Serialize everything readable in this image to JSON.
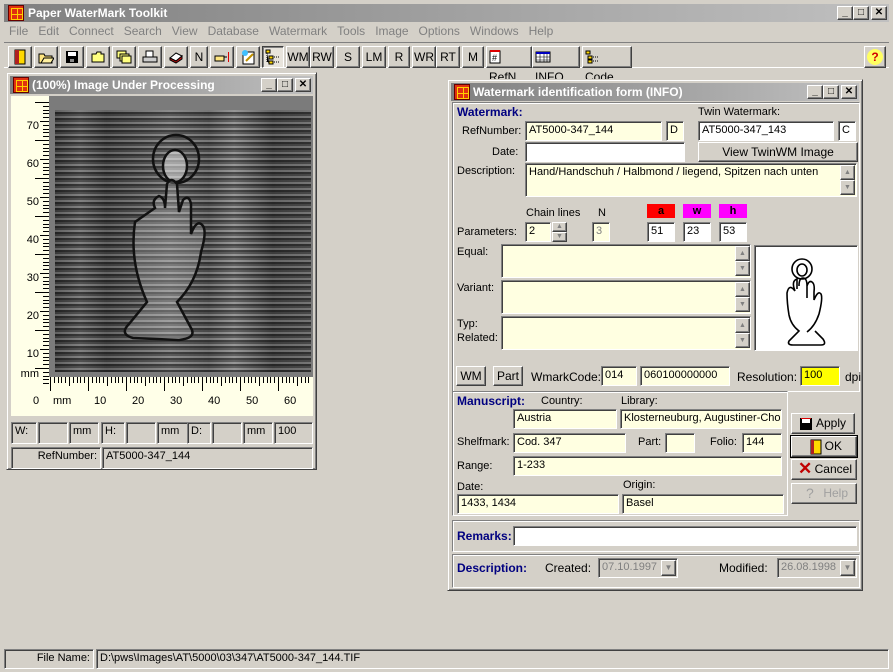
{
  "app": {
    "title": "Paper WaterMark Toolkit"
  },
  "menu": [
    "File",
    "Edit",
    "Connect",
    "Search",
    "View",
    "Database",
    "Watermark",
    "Tools",
    "Image",
    "Options",
    "Windows",
    "Help"
  ],
  "toolbar": {
    "text_buttons": {
      "n": "N",
      "wm": "WM",
      "rw": "RW",
      "s": "S",
      "lm": "LM",
      "r": "R",
      "wr": "WR",
      "rt": "RT",
      "m": "M",
      "refn": "RefN",
      "info": "INFO",
      "code": "Code"
    },
    "help_glyph": "?"
  },
  "image_window": {
    "title": "(100%) Image Under Processing",
    "vruler_labels": [
      "70",
      "60",
      "50",
      "40",
      "30",
      "20",
      "10",
      "mm"
    ],
    "hruler_labels": [
      "0",
      "mm",
      "10",
      "20",
      "30",
      "40",
      "50",
      "60"
    ],
    "measure": {
      "w_label": "W:",
      "w_value": "",
      "w_unit": "mm",
      "h_label": "H:",
      "h_value": "",
      "h_unit": "mm",
      "d_label": "D:",
      "d_value": "",
      "d_unit": "mm",
      "zoom": "100"
    },
    "refnumber_label": "RefNumber:",
    "refnumber_value": "AT5000-347_144"
  },
  "info_form": {
    "title": "Watermark identification form (INFO)",
    "watermark_section": "Watermark:",
    "refnumber_label": "RefNumber:",
    "refnumber_value": "AT5000-347_144",
    "refnumber_suffix": "D",
    "twin_label": "Twin Watermark:",
    "twin_value": "AT5000-347_143",
    "twin_suffix": "C",
    "date_label": "Date:",
    "date_value": "",
    "view_twin_button": "View TwinWM Image",
    "description_label": "Description:",
    "description_value": "Hand/Handschuh / Halbmond / liegend, Spitzen nach unten",
    "parameters_label": "Parameters:",
    "chain_lines_label": "Chain lines",
    "chain_lines_value": "2",
    "n_label": "N",
    "n_value": "3",
    "a_label": "a",
    "a_value": "51",
    "w_label": "w",
    "w_value": "23",
    "h_label": "h",
    "h_value": "53",
    "colors": {
      "a": "#ff0000",
      "w": "#ff00ff",
      "h": "#ff00ff",
      "resolution_bg": "#ffff00"
    },
    "equal_label": "Equal:",
    "equal_value": "",
    "variant_label": "Variant:",
    "variant_value": "",
    "typ_label": "Typ:",
    "related_label": "Related:",
    "typ_value": "",
    "wm_button": "WM",
    "part_button": "Part",
    "wmarkcode_label": "WmarkCode:",
    "wmarkcode_1": "014",
    "wmarkcode_2": "060100000000",
    "resolution_label": "Resolution:",
    "resolution_value": "100",
    "resolution_unit": "dpi",
    "manuscript_section": "Manuscript:",
    "country_label": "Country:",
    "country_value": "Austria",
    "library_label": "Library:",
    "library_value": "Klosterneuburg, Augustiner-Chor",
    "shelfmark_label": "Shelfmark:",
    "shelfmark_value": "Cod. 347",
    "part_label": "Part:",
    "part_value": "",
    "folio_label": "Folio:",
    "folio_value": "144",
    "range_label": "Range:",
    "range_value": "1-233",
    "ms_date_label": "Date:",
    "ms_date_value": "1433, 1434",
    "origin_label": "Origin:",
    "origin_value": "Basel",
    "apply_button": "Apply",
    "ok_button": "OK",
    "cancel_button": "Cancel",
    "help_button": "Help",
    "remarks_label": "Remarks:",
    "remarks_value": "",
    "description_section": "Description:",
    "created_label": "Created:",
    "created_value": "07.10.1997",
    "modified_label": "Modified:",
    "modified_value": "26.08.1998"
  },
  "statusbar": {
    "label": "File Name:",
    "value": "D:\\pws\\Images\\AT\\5000\\03\\347\\AT5000-347_144.TIF"
  }
}
